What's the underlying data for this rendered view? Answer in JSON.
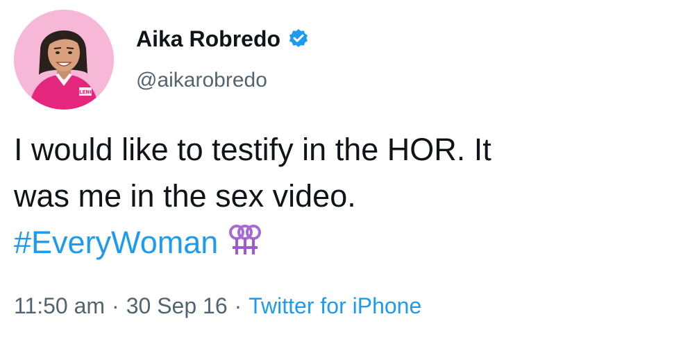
{
  "author": {
    "display_name": "Aika Robredo",
    "handle": "@aikarobredo",
    "verified": true,
    "avatar_shirt_text": "LENI"
  },
  "tweet": {
    "line1": "I would like to testify in the HOR. It",
    "line2": "was me in the sex video.",
    "hashtag": "#EveryWoman",
    "emoji": "female-signs-icon"
  },
  "meta": {
    "time": "11:50 am",
    "date": "30 Sep 16",
    "separator": "·",
    "source": "Twitter for iPhone"
  },
  "colors": {
    "link": "#1d9bf0",
    "text": "#0f1419",
    "secondary": "#536471",
    "avatar_bg": "#f6b8d6",
    "shirt": "#e5267d"
  }
}
